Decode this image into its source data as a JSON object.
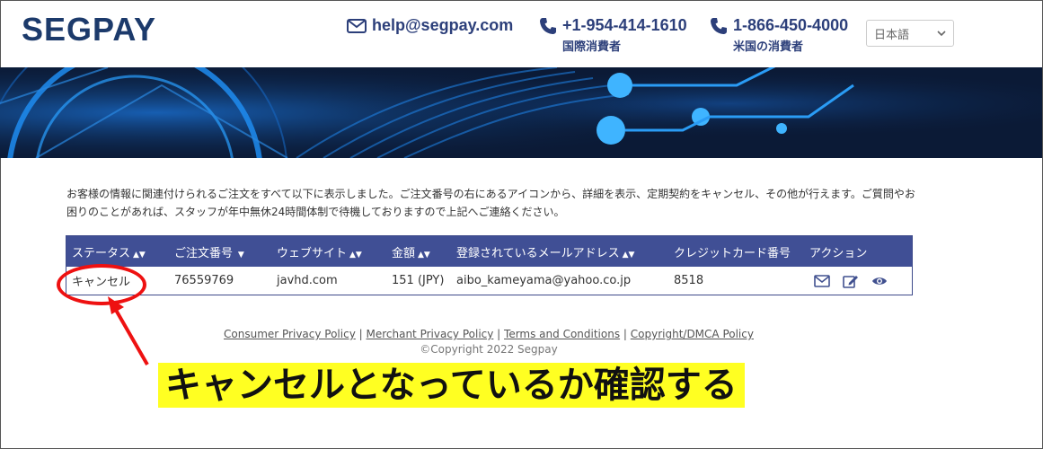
{
  "header": {
    "logo": "SEGPAY",
    "email": "help@segpay.com",
    "phone_international": "+1-954-414-1610",
    "phone_international_label": "国際消費者",
    "phone_us": "1-866-450-4000",
    "phone_us_label": "米国の消費者",
    "language_selected": "日本語"
  },
  "intro_text": "お客様の情報に関連付けられるご注文をすべて以下に表示しました。ご注文番号の右にあるアイコンから、詳細を表示、定期契約をキャンセル、その他が行えます。ご質問やお困りのことがあれば、スタッフが年中無休24時間体制で待機しておりますので上記へご連絡ください。",
  "table": {
    "headers": [
      "ステータス",
      "ご注文番号",
      "ウェブサイト",
      "金額",
      "登録されているメールアドレス",
      "クレジットカード番号",
      "アクション"
    ],
    "rows": [
      {
        "status": "キャンセル",
        "order": "76559769",
        "website": "javhd.com",
        "amount": "151 (JPY)",
        "email": "aibo_kameyama@yahoo.co.jp",
        "card": "8518"
      }
    ]
  },
  "footer": {
    "links": [
      "Consumer Privacy Policy",
      "Merchant Privacy Policy",
      "Terms and Conditions",
      "Copyright/DMCA Policy"
    ],
    "copyright": "©Copyright 2022 Segpay"
  },
  "annotation": "キャンセルとなっているか確認する",
  "colors": {
    "brand": "#1c3a6b",
    "table_header": "#404f95",
    "highlight": "#ffff22",
    "annotation_red": "#e11111"
  }
}
